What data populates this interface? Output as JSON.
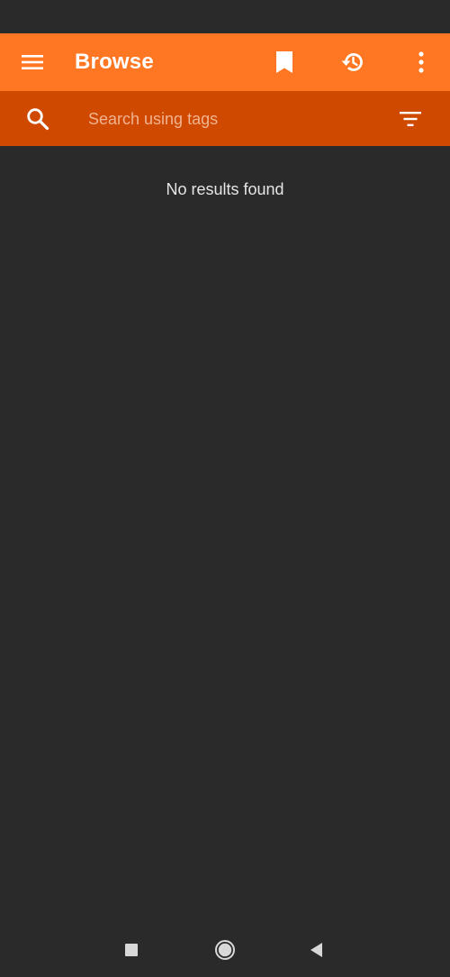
{
  "app_bar": {
    "title": "Browse",
    "background": "#ff7722",
    "icons": [
      "menu-icon",
      "bookmark-icon",
      "history-icon",
      "more-vert-icon"
    ]
  },
  "search": {
    "placeholder": "Search using tags",
    "value": "",
    "background": "#cf4a00",
    "icons": [
      "search-icon",
      "filter-icon"
    ]
  },
  "content": {
    "empty_message": "No results found",
    "background": "#2a2a2a"
  },
  "nav_bar": {
    "icons": [
      "recent-apps-icon",
      "home-icon",
      "back-icon"
    ]
  }
}
